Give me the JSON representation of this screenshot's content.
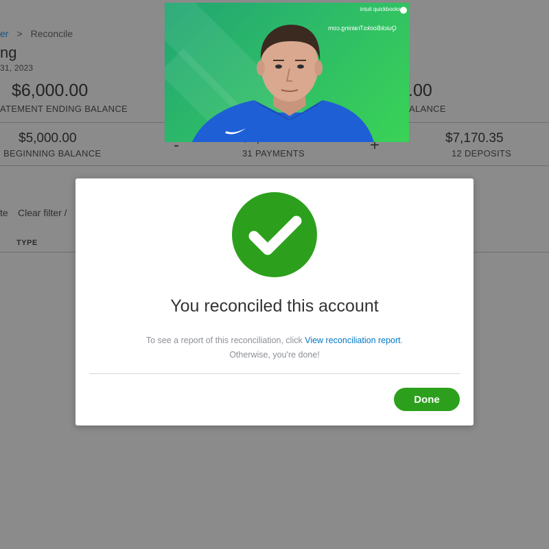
{
  "background": {
    "breadcrumb": {
      "parent": "er",
      "separator": ">",
      "current": "Reconcile"
    },
    "account_title": "ng",
    "statement_date": "31, 2023",
    "statement_ending_balance": {
      "amount": "$6,000.00",
      "label": "ATEMENT ENDING BALANCE"
    },
    "difference": {
      "amount": ".00",
      "label": "ALANCE"
    },
    "summary": {
      "beginning": {
        "amount": "$5,000.00",
        "label": "BEGINNING BALANCE"
      },
      "minus_sign": "-",
      "payments": {
        "amount": "$6,170.35",
        "label": "31 PAYMENTS"
      },
      "plus_sign": "+",
      "deposits": {
        "amount": "$7,170.35",
        "label": "12 DEPOSITS"
      }
    },
    "filter": {
      "date_fragment": "te",
      "clear_filter": "Clear filter /"
    },
    "table": {
      "col_type": "TYPE"
    }
  },
  "video": {
    "brand": "intuit quickbooks",
    "site": "QuickBooksTraining.com"
  },
  "modal": {
    "title": "You reconciled this account",
    "message_prefix": "To see a report of this reconciliation, click ",
    "message_link": "View reconciliation report",
    "message_suffix": ".",
    "message_line2": "Otherwise, you're done!",
    "done_label": "Done"
  },
  "colors": {
    "accent_green": "#2ca01c",
    "link_blue": "#0077c5",
    "overlay_gray": "#8b8b8b"
  }
}
